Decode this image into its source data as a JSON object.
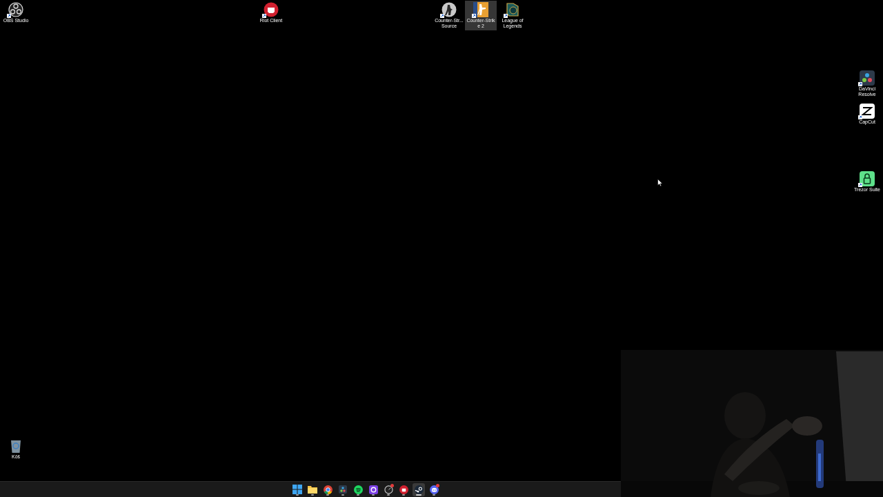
{
  "desktop_icons": [
    {
      "label": "OBS Studio",
      "selected": false
    },
    {
      "label": "Riot Client",
      "selected": false
    },
    {
      "label": "Counter-Str...\nSource",
      "selected": false
    },
    {
      "label": "Counter-Strik\ne 2",
      "selected": true
    },
    {
      "label": "League of\nLegends",
      "selected": false
    },
    {
      "label": "DaVinci\nResolve",
      "selected": false
    },
    {
      "label": "CapCut",
      "selected": false
    },
    {
      "label": "Trezor Suite",
      "selected": false
    },
    {
      "label": "Kôš",
      "selected": false
    }
  ],
  "taskbar": {
    "items": [
      {
        "active": false,
        "badge": false
      },
      {
        "active": false,
        "badge": false
      },
      {
        "active": false,
        "badge": false
      },
      {
        "active": false,
        "badge": false
      },
      {
        "active": false,
        "badge": false
      },
      {
        "active": false,
        "badge": false
      },
      {
        "active": false,
        "badge": true
      },
      {
        "active": false,
        "badge": false
      },
      {
        "active": true,
        "badge": false
      },
      {
        "active": false,
        "badge": true
      }
    ]
  }
}
